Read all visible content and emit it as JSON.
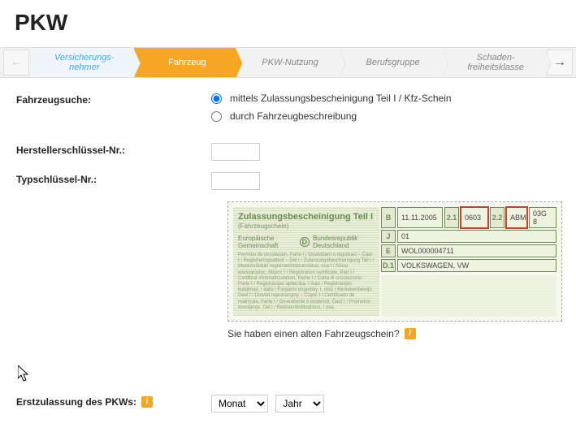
{
  "page": {
    "title": "PKW"
  },
  "wizard": {
    "steps": [
      "Versicherungs-\nnehmer",
      "Fahrzeug",
      "PKW-Nutzung",
      "Berufsgruppe",
      "Schaden-\nfreiheitsklasse"
    ]
  },
  "search": {
    "label": "Fahrzeugsuche:",
    "opt1": "mittels Zulassungsbescheinigung Teil I / Kfz-Schein",
    "opt2": "durch Fahrzeugbeschreibung"
  },
  "hsn": {
    "label": "Herstellerschlüssel-Nr.:",
    "value": ""
  },
  "tsn": {
    "label": "Typschlüssel-Nr.:",
    "value": ""
  },
  "cert": {
    "title": "Zulassungsbescheinigung Teil I",
    "sub": "(Fahrzeugschein)",
    "eu": "Europäische Gemeinschaft",
    "de": "Bundesrepublik Deutschland",
    "d": "D",
    "b": {
      "lbl": "B",
      "date": "11.11.2005",
      "c21": "2.1",
      "hsn": "0603",
      "c22": "2.2",
      "tsn1": "ABM",
      "tsn2": "03G 8"
    },
    "j": {
      "lbl": "J",
      "val": "01"
    },
    "e": {
      "lbl": "E",
      "val": "WOL000004711"
    },
    "d1": {
      "lbl": "D.1",
      "val": "VOLKSWAGEN, VW"
    }
  },
  "help": {
    "text": "Sie haben einen alten Fahrzeugschein?"
  },
  "firstreg": {
    "label": "Erstzulassung des PKWs:",
    "month": "Monat",
    "year": "Jahr"
  }
}
